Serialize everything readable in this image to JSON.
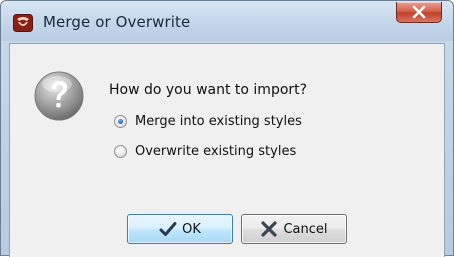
{
  "dialog": {
    "title": "Merge or Overwrite",
    "question": "How do you want to import?",
    "options": [
      {
        "label": "Merge into existing styles",
        "selected": true
      },
      {
        "label": "Overwrite existing styles",
        "selected": false
      }
    ],
    "buttons": {
      "ok_label": "OK",
      "cancel_label": "Cancel"
    }
  },
  "icons": {
    "app": "app-logo-icon",
    "close": "close-icon",
    "question": "question-mark-icon",
    "ok": "checkmark-icon",
    "cancel": "x-cross-icon"
  },
  "colors": {
    "titlebar": "#c4d6ea",
    "close_button": "#c2402b",
    "client_background": "#f0f0f0",
    "ok_button": "#bee6fd",
    "radio_selected": "#1f5fb5"
  }
}
